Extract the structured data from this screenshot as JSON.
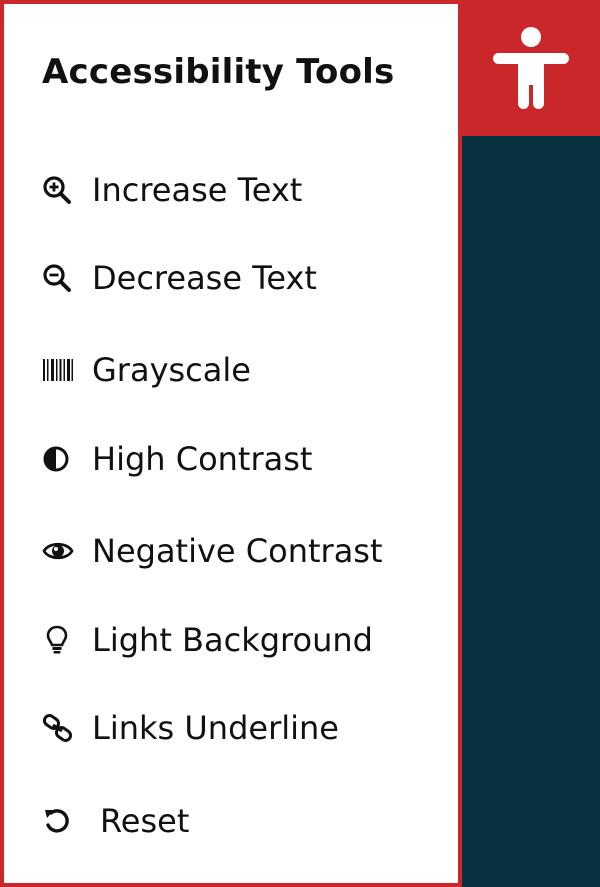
{
  "panel": {
    "title": "Accessibility Tools"
  },
  "menu": {
    "items": [
      {
        "label": "Increase Text",
        "icon": "zoom-in-icon"
      },
      {
        "label": "Decrease Text",
        "icon": "zoom-out-icon"
      },
      {
        "label": "Grayscale",
        "icon": "barcode-icon"
      },
      {
        "label": "High Contrast",
        "icon": "contrast-icon"
      },
      {
        "label": "Negative Contrast",
        "icon": "eye-icon"
      },
      {
        "label": "Light Background",
        "icon": "lightbulb-icon"
      },
      {
        "label": "Links Underline",
        "icon": "link-icon"
      },
      {
        "label": "Reset",
        "icon": "reset-icon"
      }
    ]
  },
  "colors": {
    "accent": "#c9272a",
    "background": "#06333f",
    "panel": "#ffffff",
    "text": "#111111"
  },
  "toggle": {
    "icon": "accessibility-person-icon"
  }
}
